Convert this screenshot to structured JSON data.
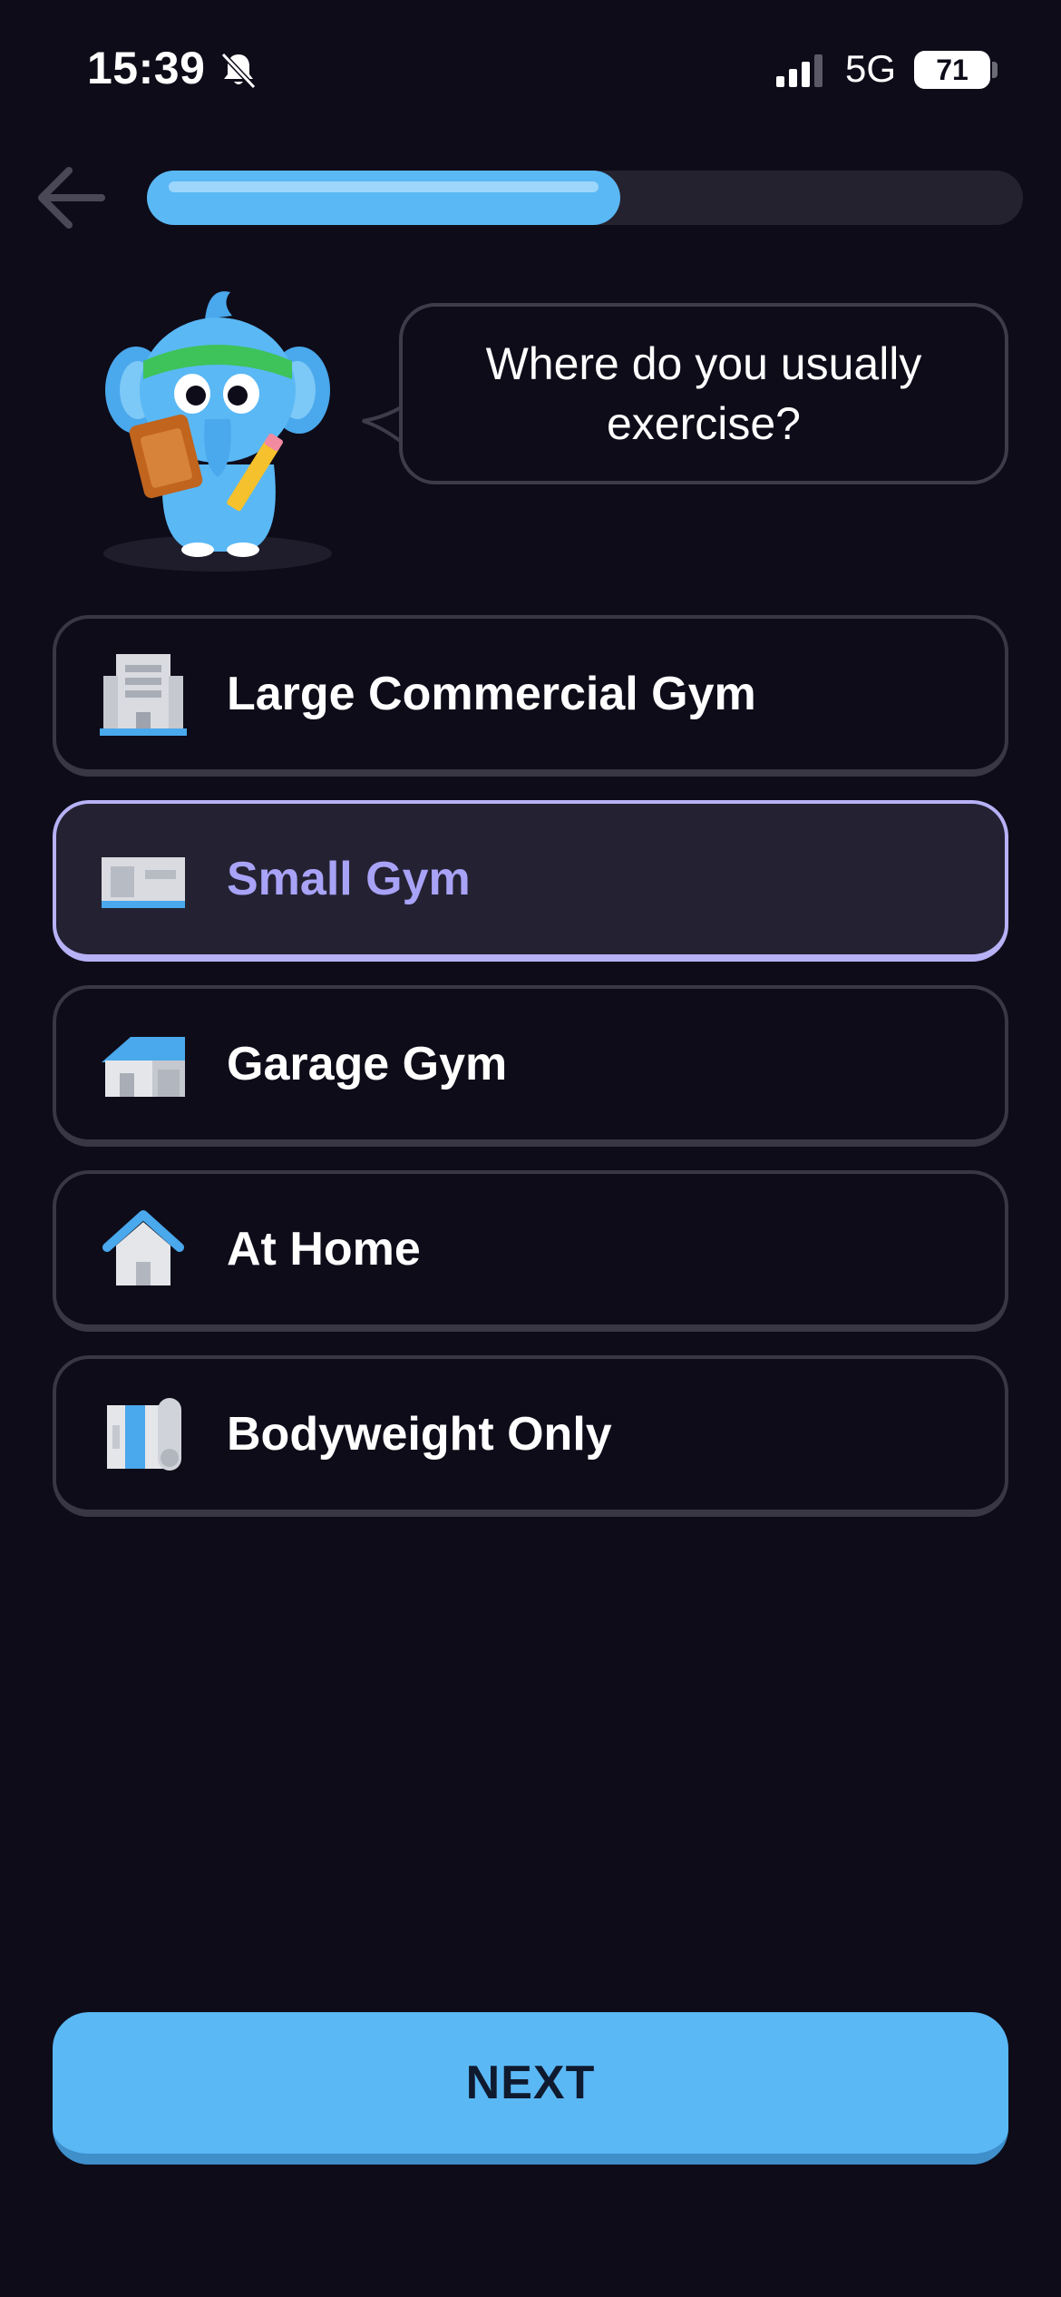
{
  "status_bar": {
    "time": "15:39",
    "network": "5G",
    "battery": "71",
    "icons": [
      "bell-slash-icon",
      "signal-bars-icon",
      "battery-icon"
    ]
  },
  "header": {
    "back_icon": "arrow-left-icon",
    "progress": 0.54
  },
  "prompt": {
    "question": "Where do you usually exercise?",
    "mascot": "elephant-mascot-with-clipboard"
  },
  "options": [
    {
      "label": "Large Commercial Gym",
      "icon": "office-building-icon",
      "selected": false
    },
    {
      "label": "Small Gym",
      "icon": "small-building-icon",
      "selected": true
    },
    {
      "label": "Garage Gym",
      "icon": "garage-house-icon",
      "selected": false
    },
    {
      "label": "At Home",
      "icon": "house-icon",
      "selected": false
    },
    {
      "label": "Bodyweight Only",
      "icon": "exercise-mat-icon",
      "selected": false
    }
  ],
  "footer": {
    "next_label": "NEXT"
  },
  "colors": {
    "background": "#0e0c19",
    "accent": "#5ab8f5",
    "selected_border": "#b7b1f6",
    "selected_text": "#a9a3f7"
  }
}
